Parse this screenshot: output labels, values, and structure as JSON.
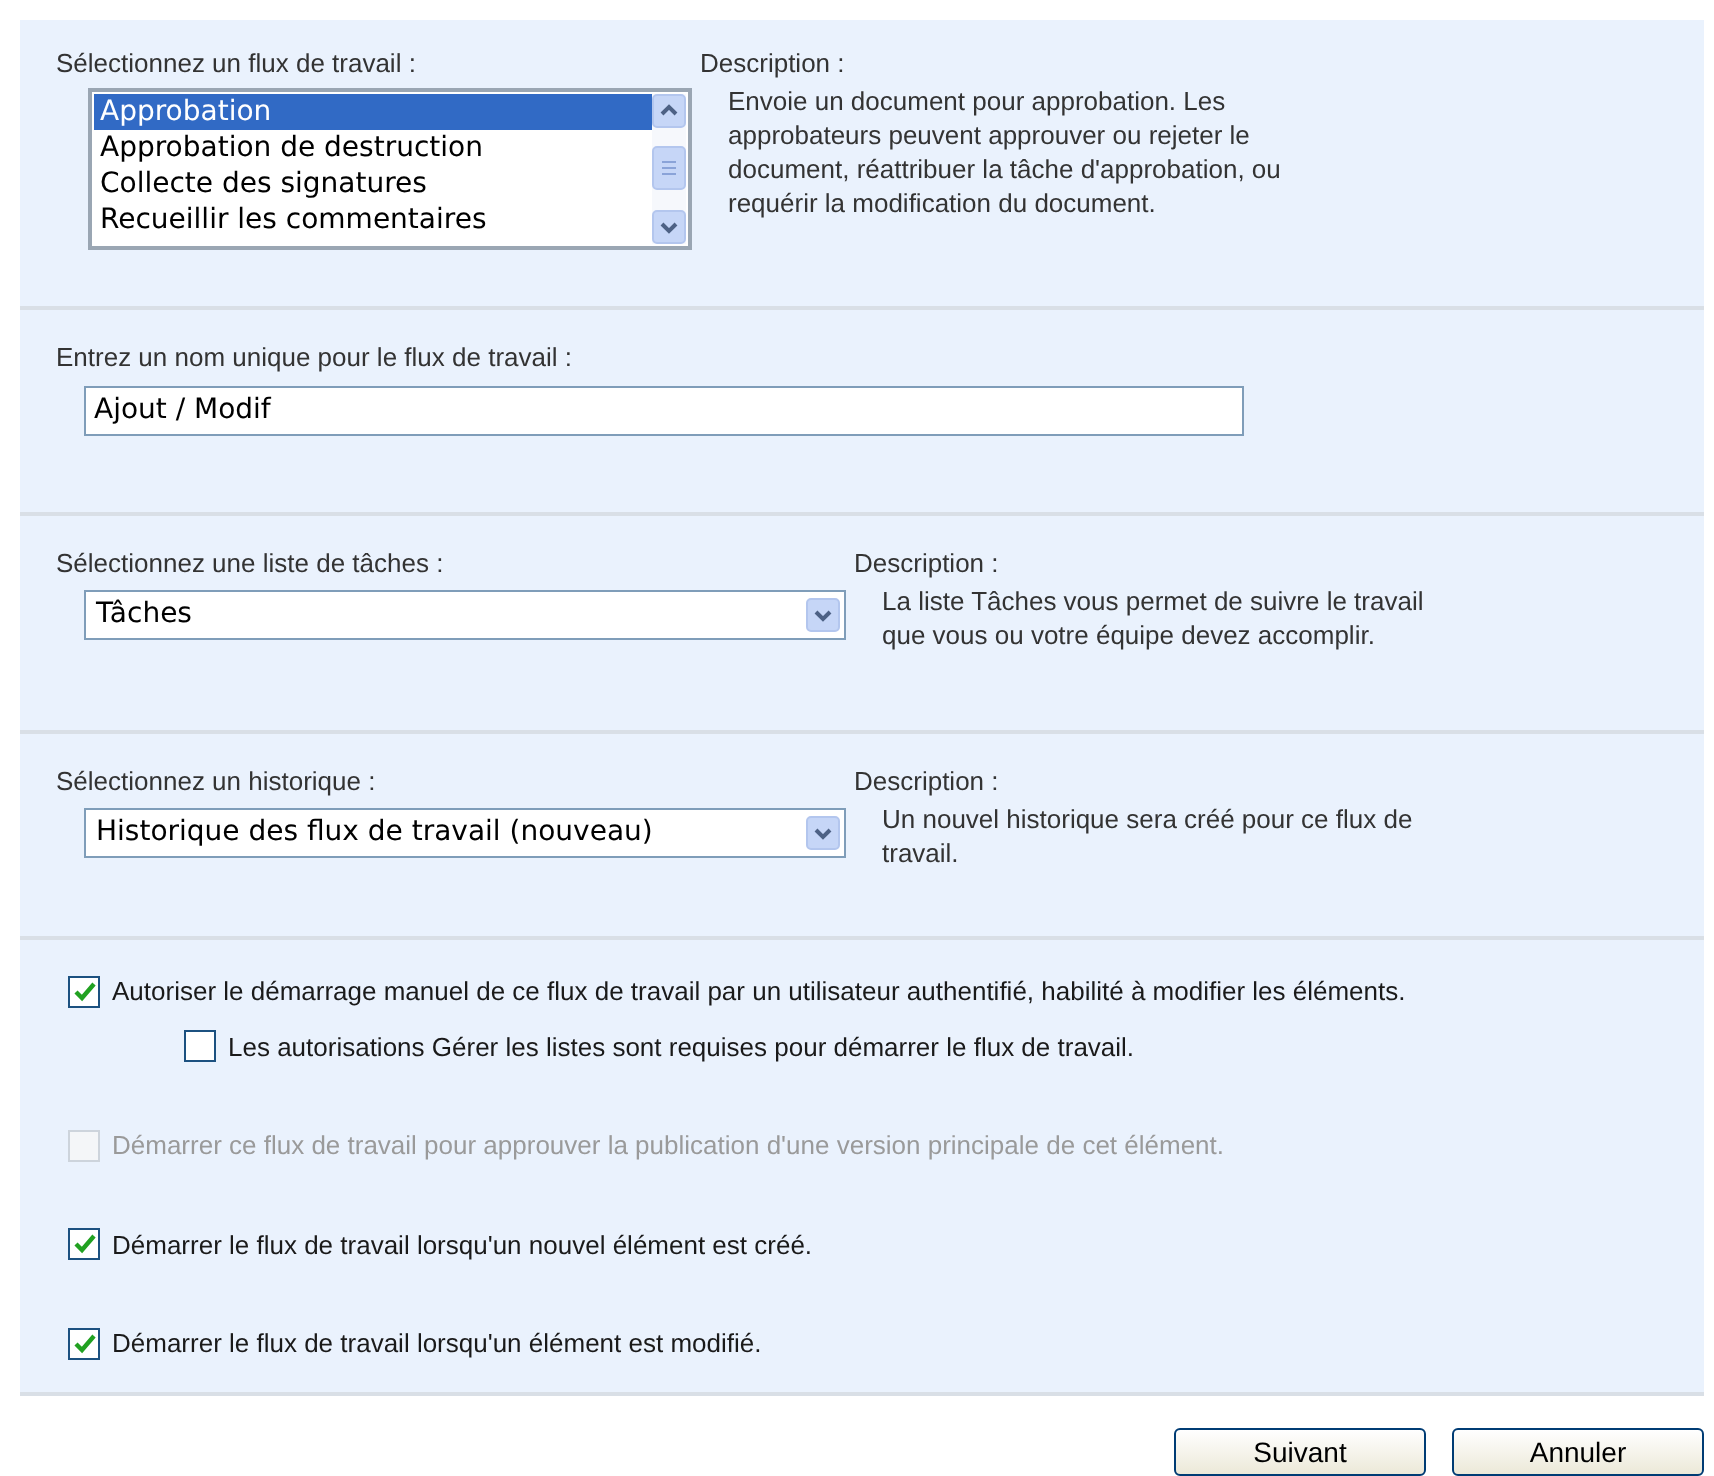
{
  "workflow_section": {
    "label": "Sélectionnez un flux de travail :",
    "items": [
      {
        "label": "Approbation",
        "selected": true
      },
      {
        "label": "Approbation de destruction",
        "selected": false
      },
      {
        "label": "Collecte des signatures",
        "selected": false
      },
      {
        "label": "Recueillir les commentaires",
        "selected": false
      }
    ],
    "description_label": "Description :",
    "description": "Envoie un document pour approbation. Les approbateurs peuvent approuver ou rejeter le document, réattribuer la tâche d'approbation, ou requérir la modification du document."
  },
  "name_section": {
    "label": "Entrez un nom unique pour le flux de travail :",
    "value": "Ajout / Modif"
  },
  "task_list_section": {
    "label": "Sélectionnez une liste de tâches :",
    "value": "Tâches",
    "description_label": "Description :",
    "description": "La liste Tâches vous permet de suivre le travail que vous ou votre équipe devez accomplir."
  },
  "history_section": {
    "label": "Sélectionnez un historique :",
    "value": "Historique des flux de travail (nouveau)",
    "description_label": "Description :",
    "description": "Un nouvel historique sera créé pour ce flux de travail."
  },
  "options": [
    {
      "label": "Autoriser le démarrage manuel de ce flux de travail par un utilisateur authentifié, habilité à modifier les éléments.",
      "checked": true,
      "disabled": false,
      "children": [
        {
          "label": "Les autorisations Gérer les listes sont requises pour démarrer le flux de travail.",
          "checked": false,
          "disabled": false
        }
      ]
    },
    {
      "label": "Démarrer ce flux de travail pour approuver la publication d'une version principale de cet élément.",
      "checked": false,
      "disabled": true
    },
    {
      "label": "Démarrer le flux de travail lorsqu'un nouvel élément est créé.",
      "checked": true,
      "disabled": false
    },
    {
      "label": "Démarrer le flux de travail lorsqu'un élément est modifié.",
      "checked": true,
      "disabled": false
    }
  ],
  "buttons": [
    "Suivant",
    "Annuler"
  ]
}
